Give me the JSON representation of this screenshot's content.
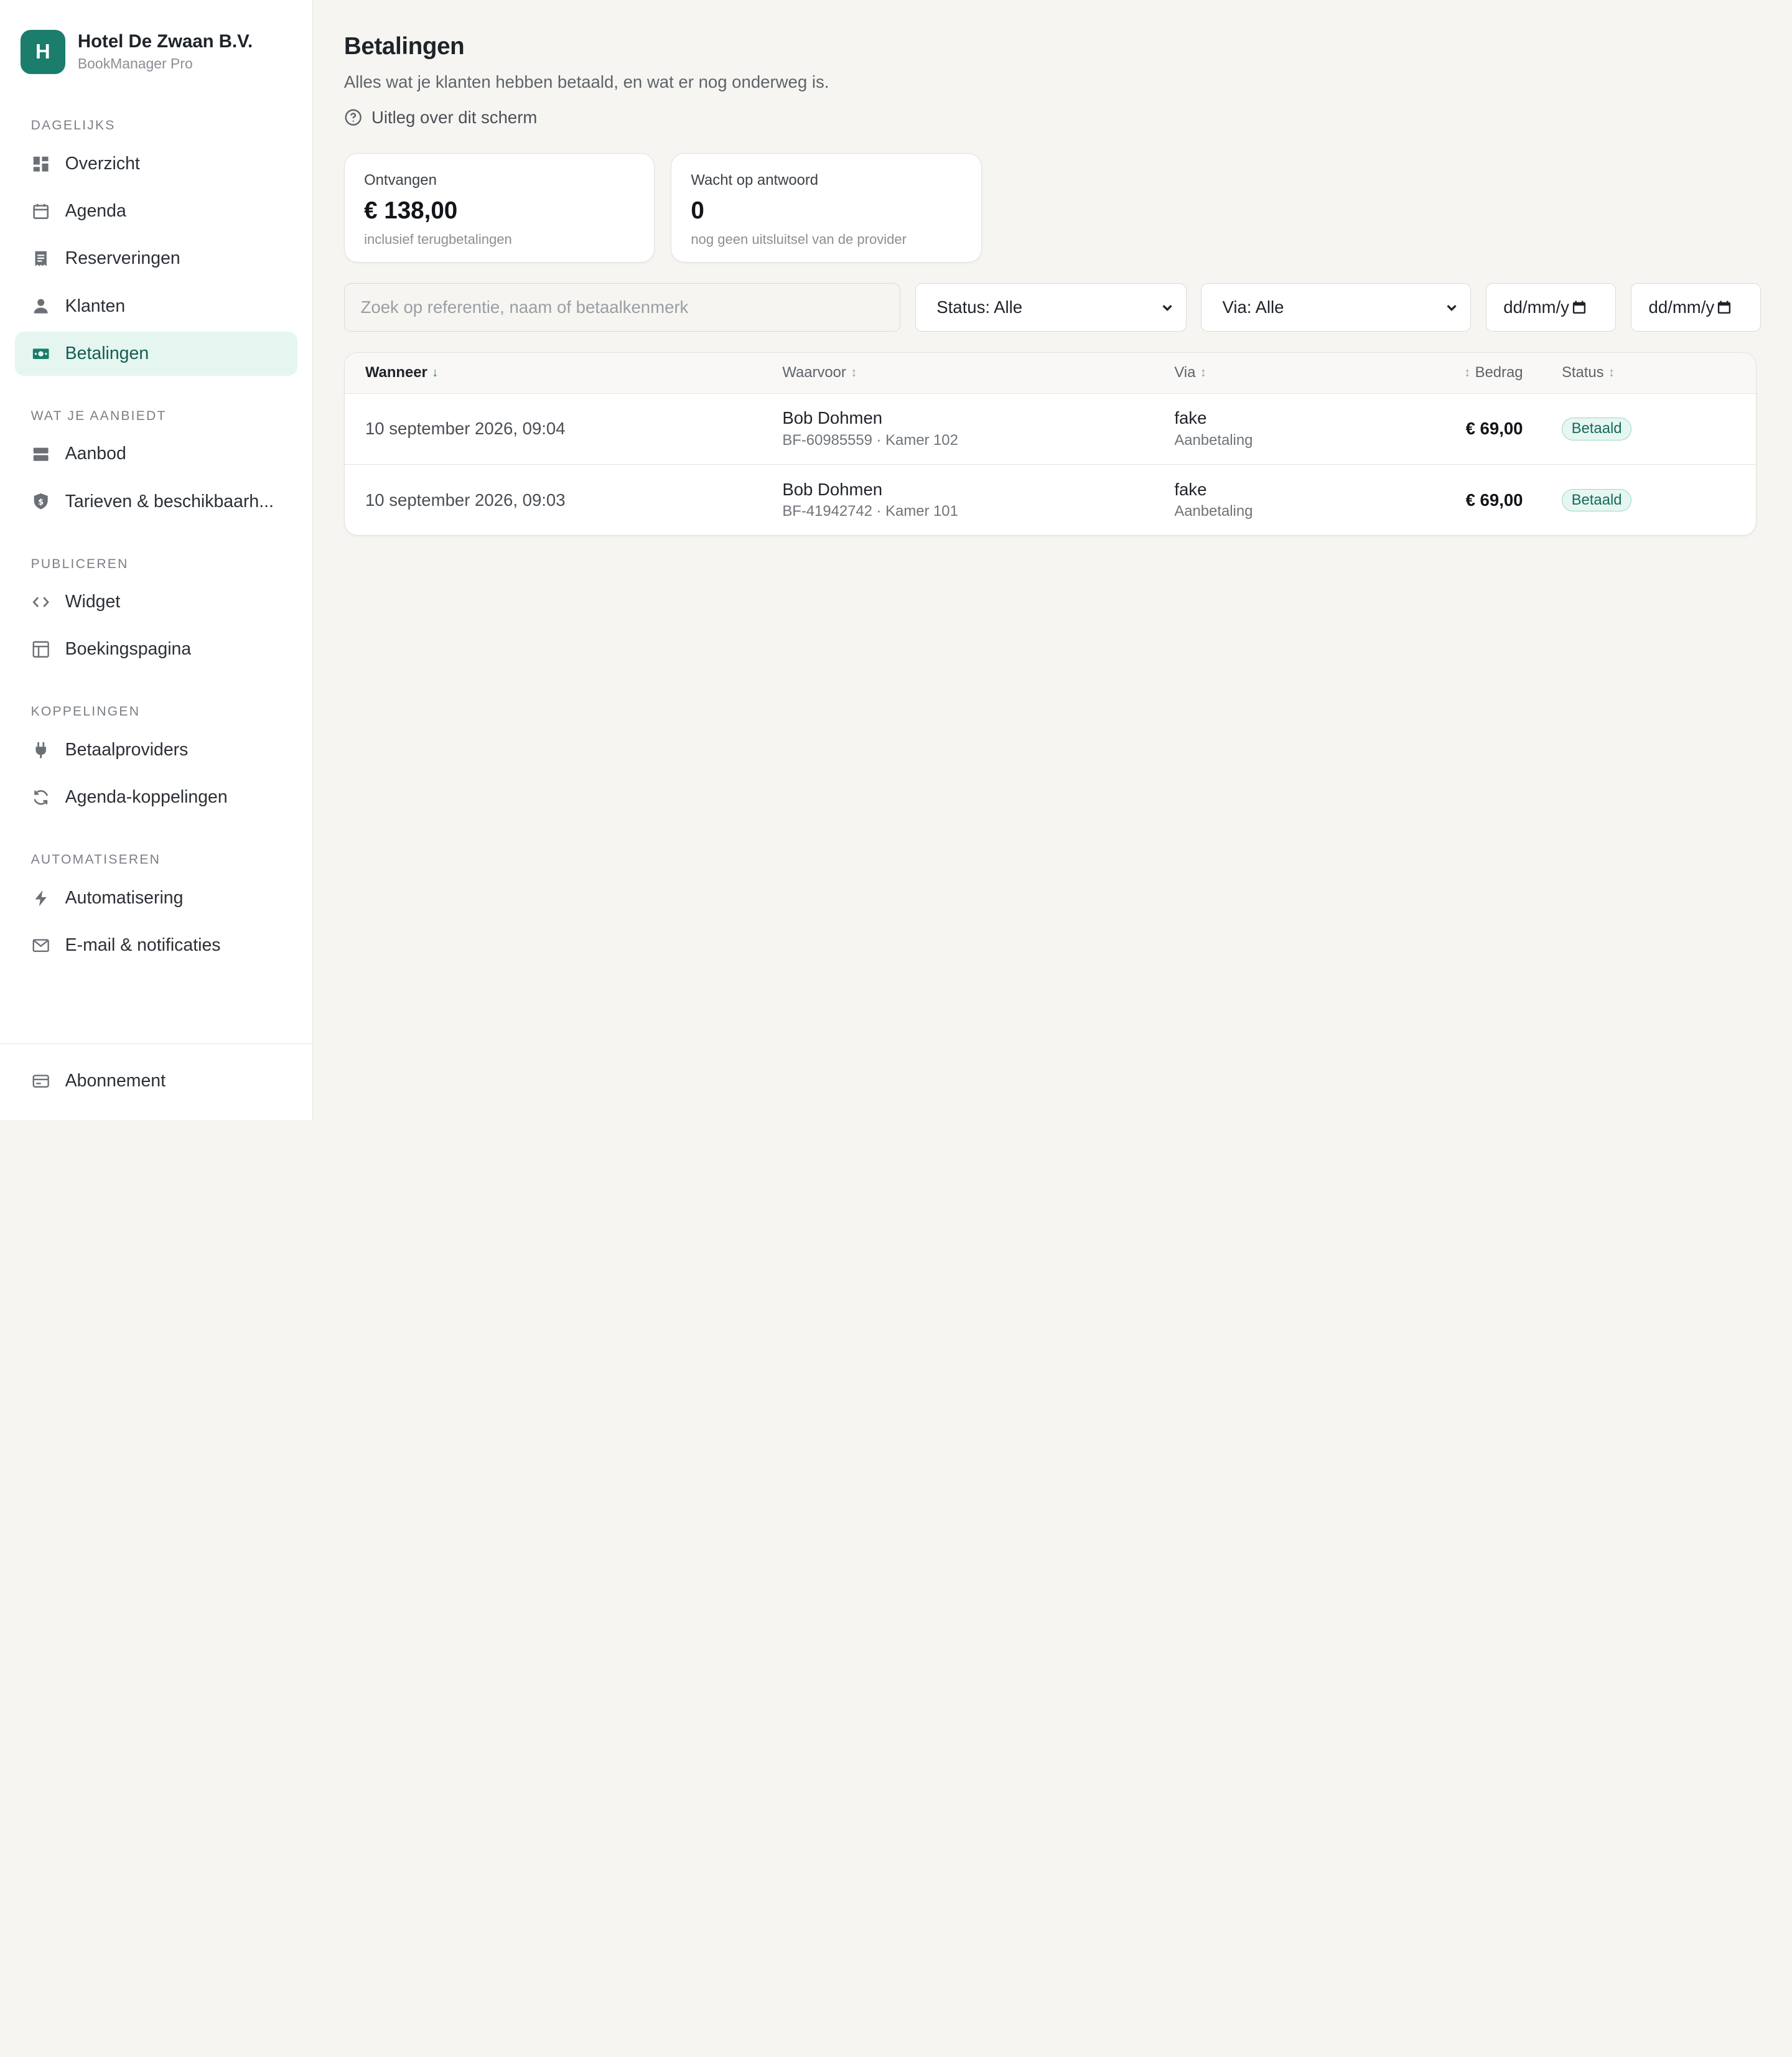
{
  "brand": {
    "initial": "H",
    "name": "Hotel De Zwaan B.V.",
    "product": "BookManager Pro"
  },
  "sidebar": {
    "sections": [
      {
        "label": "DAGELIJKS",
        "items": [
          {
            "label": "Overzicht",
            "icon": "dashboard-icon"
          },
          {
            "label": "Agenda",
            "icon": "calendar-icon"
          },
          {
            "label": "Reserveringen",
            "icon": "receipt-icon"
          },
          {
            "label": "Klanten",
            "icon": "person-icon"
          },
          {
            "label": "Betalingen",
            "icon": "banknote-icon",
            "active": true
          }
        ]
      },
      {
        "label": "WAT JE AANBIEDT",
        "items": [
          {
            "label": "Aanbod",
            "icon": "stack-icon"
          },
          {
            "label": "Tarieven & beschikbaarh...",
            "icon": "price-shield-icon"
          }
        ]
      },
      {
        "label": "PUBLICEREN",
        "items": [
          {
            "label": "Widget",
            "icon": "code-icon"
          },
          {
            "label": "Boekingspagina",
            "icon": "layout-icon"
          }
        ]
      },
      {
        "label": "KOPPELINGEN",
        "items": [
          {
            "label": "Betaalproviders",
            "icon": "plug-icon"
          },
          {
            "label": "Agenda-koppelingen",
            "icon": "sync-icon"
          }
        ]
      },
      {
        "label": "AUTOMATISEREN",
        "items": [
          {
            "label": "Automatisering",
            "icon": "bolt-icon"
          },
          {
            "label": "E-mail & notificaties",
            "icon": "mail-icon"
          }
        ]
      }
    ],
    "bottom_item": {
      "label": "Abonnement",
      "icon": "credit-card-icon"
    }
  },
  "page": {
    "title": "Betalingen",
    "subtitle": "Alles wat je klanten hebben betaald, en wat er nog onderweg is.",
    "help_link": "Uitleg over dit scherm"
  },
  "stats": [
    {
      "label": "Ontvangen",
      "value": "€ 138,00",
      "hint": "inclusief terugbetalingen"
    },
    {
      "label": "Wacht op antwoord",
      "value": "0",
      "hint": "nog geen uitsluitsel van de provider"
    }
  ],
  "filters": {
    "search_placeholder": "Zoek op referentie, naam of betaalkenmerk",
    "search_value": "",
    "status_select": "Status: Alle",
    "via_select": "Via: Alle",
    "date_from": "dd/mm/y",
    "date_to": "dd/mm/y"
  },
  "table": {
    "headers": {
      "when": "Wanneer",
      "when_sort": "↓",
      "what": "Waarvoor",
      "via": "Via",
      "amount": "Bedrag",
      "status": "Status",
      "sort_neutral": "↕"
    },
    "rows": [
      {
        "when": "10 september 2026, 09:04",
        "name": "Bob Dohmen",
        "detail": "BF-60985559 · Kamer 102",
        "via": "fake",
        "via_sub": "Aanbetaling",
        "amount": "€ 69,00",
        "status": "Betaald"
      },
      {
        "when": "10 september 2026, 09:03",
        "name": "Bob Dohmen",
        "detail": "BF-41942742 · Kamer 101",
        "via": "fake",
        "via_sub": "Aanbetaling",
        "amount": "€ 69,00",
        "status": "Betaald"
      }
    ]
  },
  "colors": {
    "accent": "#1b7d6b",
    "active_bg": "#e5f6f1",
    "badge_border": "#9fd8c8",
    "background": "#f6f5f2"
  }
}
